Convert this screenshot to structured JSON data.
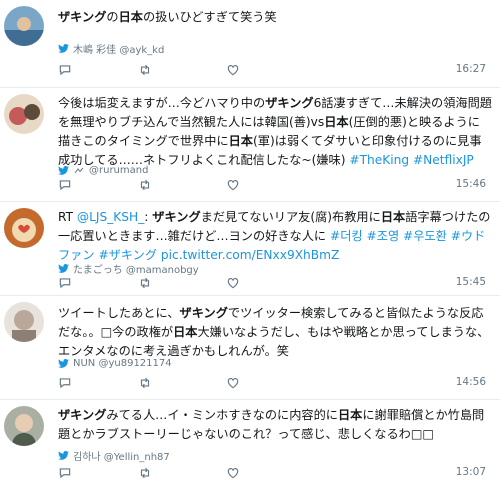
{
  "tweets": [
    {
      "id": "t1",
      "segments": [
        {
          "t": "ザキング",
          "b": true
        },
        {
          "t": "の"
        },
        {
          "t": "日本",
          "b": true
        },
        {
          "t": "の扱いひどすぎて笑う笑"
        }
      ],
      "user": "木嶋 彩佳 @ayk_kd",
      "time": "16:27",
      "avatar_color": "#7aa6c8"
    },
    {
      "id": "t2",
      "segments": [
        {
          "t": "今後は垢変えますが…今どハマり中の"
        },
        {
          "t": "ザキング",
          "b": true
        },
        {
          "t": "6話凄すぎて…未解決の領海問題を無理やりブチ込んで当然観た人には韓国(善)vs"
        },
        {
          "t": "日本",
          "b": true
        },
        {
          "t": "(圧倒的悪)と映るように描きこのタイミングで世界中に"
        },
        {
          "t": "日本",
          "b": true
        },
        {
          "t": "(軍)は弱くてダサいと印象付けるのに見事成功してる……ネトフリよくこれ配信したな~(嫌味) "
        },
        {
          "t": "#TheKing",
          "tag": true
        },
        {
          "t": " "
        },
        {
          "t": "#NetflixJP",
          "tag": true
        }
      ],
      "user": "@rurumand",
      "time": "15:46",
      "avatar_color": "#c45a5a"
    },
    {
      "id": "t3",
      "segments": [
        {
          "t": "RT "
        },
        {
          "t": "@LJS_KSH_",
          "tag": true
        },
        {
          "t": ": "
        },
        {
          "t": "ザキング",
          "b": true
        },
        {
          "t": "まだ見てないリア友(腐)布教用に"
        },
        {
          "t": "日本",
          "b": true
        },
        {
          "t": "語字幕つけたの一応置いときます…雑だけど…ヨンの好きな人に "
        },
        {
          "t": "#더킹",
          "tag": true
        },
        {
          "t": " "
        },
        {
          "t": "#조영",
          "tag": true
        },
        {
          "t": " "
        },
        {
          "t": "#우도환",
          "tag": true
        },
        {
          "t": " "
        },
        {
          "t": "#ウドファン",
          "tag": true
        },
        {
          "t": " "
        },
        {
          "t": "#ザキング",
          "tag": true
        },
        {
          "t": " "
        },
        {
          "t": "pic.twitter.com/ENxx9XhBmZ",
          "tag": true
        }
      ],
      "user": "たまごっち @mamanobgy",
      "time": "15:45",
      "avatar_color": "#d9823b"
    },
    {
      "id": "t4",
      "segments": [
        {
          "t": "ツイートしたあとに、"
        },
        {
          "t": "ザキング",
          "b": true
        },
        {
          "t": "でツイッター検索してみると皆似たような反応だな。。□今の政権が"
        },
        {
          "t": "日本",
          "b": true
        },
        {
          "t": "大嫌いなようだし、もはや戦略とか思ってしまうな、エンタメなのに考え過ぎかもしれんが。笑"
        }
      ],
      "user": "NUN @yu89121174",
      "time": "14:56",
      "avatar_color": "#b9a79a"
    },
    {
      "id": "t5",
      "segments": [
        {
          "t": "ザキング",
          "b": true
        },
        {
          "t": "みてる人…イ・ミンホすきなのに内容的に"
        },
        {
          "t": "日本",
          "b": true
        },
        {
          "t": "に謝罪賠償とか竹島問題とかラブストーリーじゃないのこれ？って感じ、悲しくなるわ□□"
        }
      ],
      "user": "김하나 @Yellin_nh87",
      "time": "13:07",
      "avatar_color": "#6d7a6a"
    }
  ],
  "icons": {
    "reply": "reply-icon",
    "retweet": "retweet-icon",
    "like": "heart-icon",
    "source": "twitter-bird-icon"
  },
  "colors": {
    "accent": "#1b95e0",
    "meta": "#657786",
    "divider": "#e6ecf0"
  }
}
